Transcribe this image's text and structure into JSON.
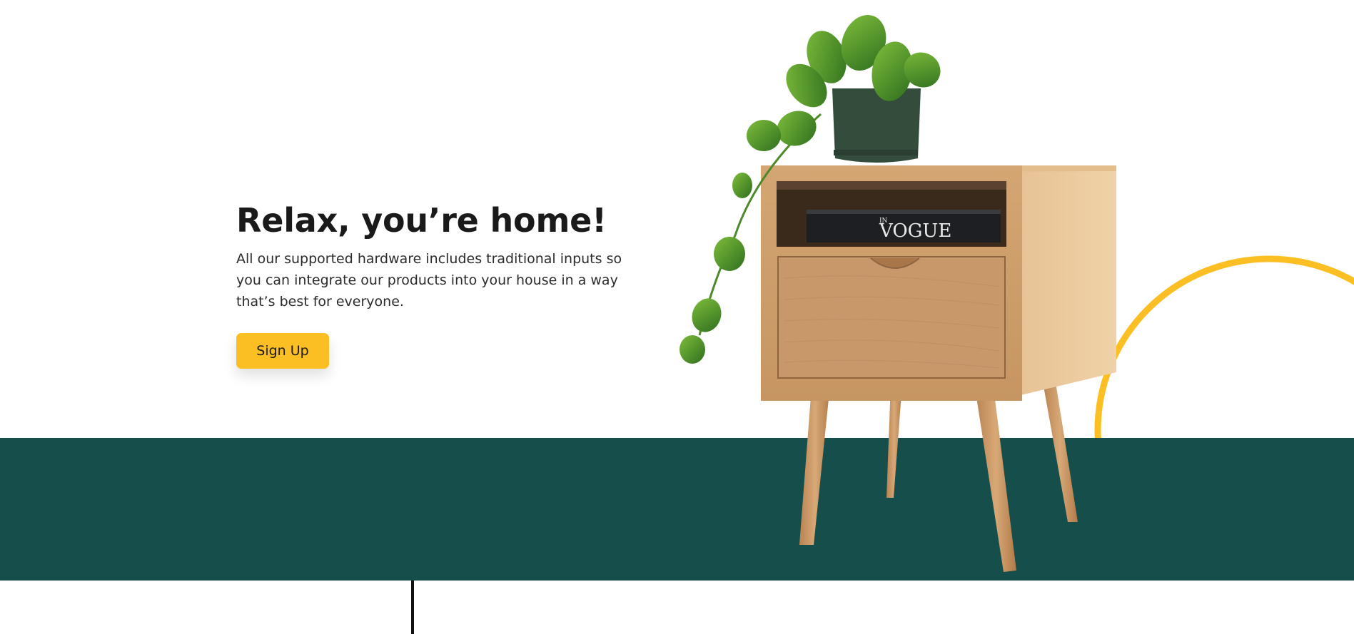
{
  "hero": {
    "heading": "Relax, you’re home!",
    "body": "All our supported hardware includes traditional inputs so you can integrate our products into your house in a way that’s best for everyone.",
    "cta_label": "Sign Up"
  },
  "illustration": {
    "book_text": "VOGUE",
    "book_prefix": "IN"
  },
  "colors": {
    "accent": "#fbbf24",
    "band": "#154e4b",
    "ring": "#fbbf24",
    "wood": "#d9ad7c",
    "pot": "#334c3c"
  },
  "icons": [
    "plant-image",
    "nightstand-image",
    "decorative-ring"
  ]
}
